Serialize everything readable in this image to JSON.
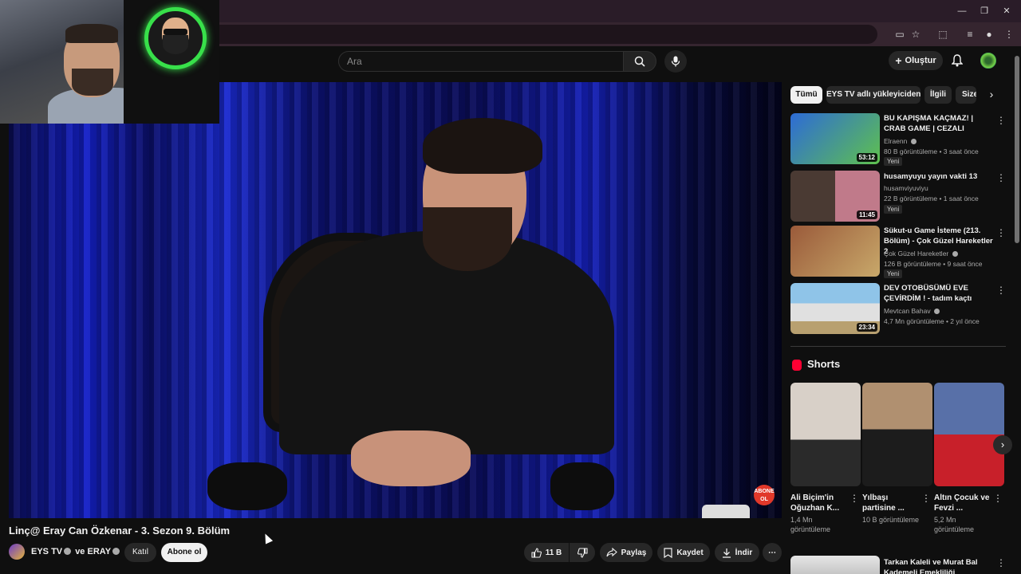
{
  "browser": {
    "window_controls": [
      "—",
      "❐",
      "✕"
    ]
  },
  "header": {
    "search_placeholder": "Ara",
    "create_label": "Oluştur"
  },
  "video": {
    "title": "Linç@ Eray Can Özkenar - 3. Sezon 9. Bölüm",
    "channel": "EYS TV",
    "channel_suffix": "ve ERAY",
    "join_label": "Katıl",
    "subscribe_label": "Abone ol",
    "likes": "11 B",
    "share_label": "Paylaş",
    "save_label": "Kaydet",
    "download_label": "İndir",
    "overlay_badge": "ABONE OL"
  },
  "chips": [
    "Tümü",
    "EYS TV adlı yükleyiciden",
    "İlgili",
    "Size"
  ],
  "recommendations": [
    {
      "title": "BU KAPIŞMA KAÇMAZ! | CRAB GAME | CEZALI",
      "channel": "Elraenn",
      "verified": true,
      "meta": "80 B görüntüleme • 3 saat önce",
      "badge": "Yeni",
      "duration": "53:12",
      "colors": [
        "#2d6bd6",
        "#5fc14e"
      ]
    },
    {
      "title": "husamyuyu yayın vakti 13",
      "channel": "husamviyuviyu",
      "verified": false,
      "meta": "22 B görüntüleme • 1 saat önce",
      "badge": "Yeni",
      "duration": "11:45",
      "colors": [
        "#4a3a33",
        "#c07a8a"
      ]
    },
    {
      "title": "Sükut-u Game İsteme (213. Bölüm) - Çok Güzel Hareketler 2",
      "channel": "Çok Güzel Hareketler",
      "verified": true,
      "meta": "126 B görüntüleme • 9 saat önce",
      "badge": "Yeni",
      "duration": "",
      "colors": [
        "#9a5a3a",
        "#c8a86a"
      ]
    },
    {
      "title": "DEV OTOBÜSÜMÜ EVE ÇEVİRDİM ! - tadım kaçtı",
      "channel": "Mevtcan Bahav",
      "verified": true,
      "meta": "4,7 Mn görüntüleme • 2 yıl önce",
      "badge": "",
      "duration": "23:34",
      "colors": [
        "#8fc4e8",
        "#e0e0e0"
      ]
    }
  ],
  "shorts": {
    "heading": "Shorts",
    "items": [
      {
        "title": "Ali Biçim'in Oğuzhan K...",
        "views": "1,4 Mn görüntüleme",
        "colors": [
          "#d8d0c8",
          "#2a2a2a"
        ]
      },
      {
        "title": "Yılbaşı partisine ...",
        "views": "10 B görüntüleme",
        "colors": [
          "#b09070",
          "#1c1c1c"
        ]
      },
      {
        "title": "Altın Çocuk ve Fevzi ...",
        "views": "5,2 Mn görüntüleme",
        "colors": [
          "#5870a8",
          "#c8202a"
        ]
      }
    ]
  },
  "next_recommendation": {
    "title": "Tarkan Kaleli ve  Murat Bal Kademeli Emekliliği Konuşuyor"
  },
  "colors": {
    "background": "#0f0f0f",
    "subscribe_bg": "#f1f1f1",
    "shorts_red": "#ff0033",
    "logo_green": "#38e04a"
  },
  "icons": [
    "search-icon",
    "mic-icon",
    "plus-icon",
    "bell-icon",
    "like-icon",
    "dislike-icon",
    "share-icon",
    "save-icon",
    "download-icon",
    "more-icon",
    "chevron-right-icon",
    "shorts-icon",
    "verified-icon"
  ]
}
